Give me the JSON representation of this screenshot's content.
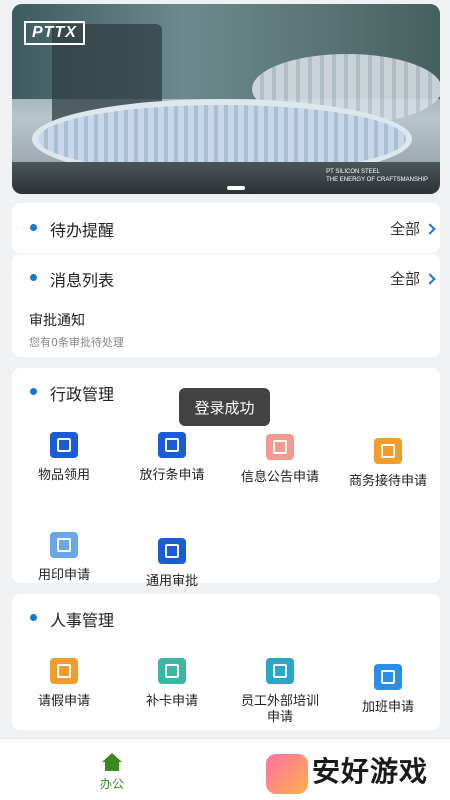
{
  "banner": {
    "logo": "PTTX",
    "caption_line1": "PT SILICON STEEL",
    "caption_line2": "THE ENERGY OF CRAFTSMANSHIP"
  },
  "todo": {
    "title": "待办提醒",
    "more": "全部"
  },
  "messages": {
    "title": "消息列表",
    "more": "全部",
    "item_title": "审批通知",
    "item_desc": "您有0条审批待处理"
  },
  "admin": {
    "title": "行政管理",
    "items": [
      {
        "label": "物品领用",
        "icon": "item-requisition-icon",
        "color": "#1a5bd8"
      },
      {
        "label": "放行条申请",
        "icon": "release-pass-icon",
        "color": "#1a5bd8"
      },
      {
        "label": "信息公告申请",
        "icon": "announcement-icon",
        "color": "#f29a8e"
      },
      {
        "label": "商务接待申请",
        "icon": "coffee-icon",
        "color": "#f39b2c"
      },
      {
        "label": "用印申请",
        "icon": "seal-icon",
        "color": "#6aa6e8"
      },
      {
        "label": "通用审批",
        "icon": "approval-icon",
        "color": "#1a5bd8"
      }
    ]
  },
  "hr": {
    "title": "人事管理",
    "items": [
      {
        "label": "请假申请",
        "icon": "leave-icon",
        "color": "#f39b2c"
      },
      {
        "label": "补卡申请",
        "icon": "calendar-icon",
        "color": "#3bb5a4"
      },
      {
        "label": "员工外部培训申请",
        "icon": "training-icon",
        "color": "#2aa7c8"
      },
      {
        "label": "加班申请",
        "icon": "overtime-icon",
        "color": "#2a8fe8"
      }
    ]
  },
  "toast": "登录成功",
  "tabbar": {
    "office": "办公"
  },
  "watermark": {
    "text": "安好游戏"
  }
}
